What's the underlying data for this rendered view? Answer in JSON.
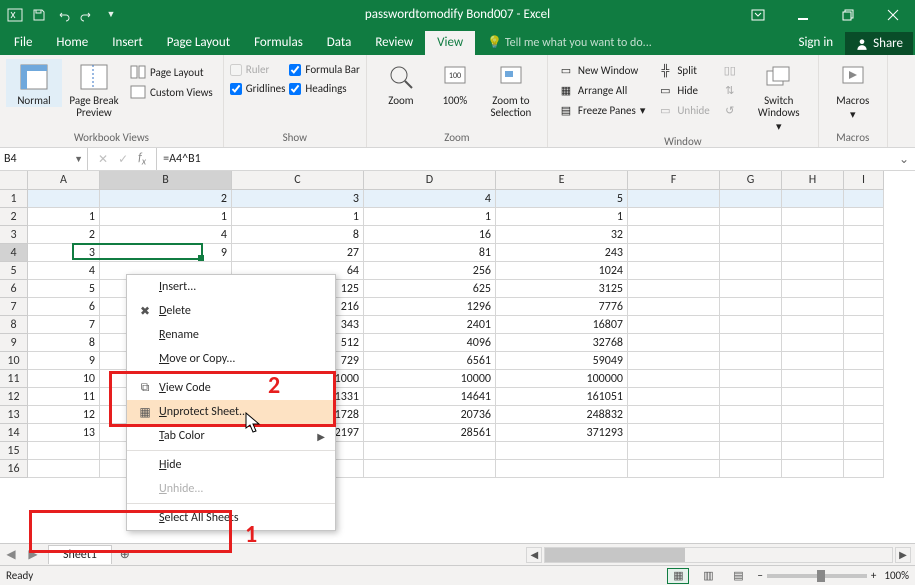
{
  "titlebar": {
    "title": "passwordtomodify Bond007 - Excel"
  },
  "tabs": {
    "file": "File",
    "items": [
      "Home",
      "Insert",
      "Page Layout",
      "Formulas",
      "Data",
      "Review",
      "View"
    ],
    "active": "View",
    "tell": "Tell me what you want to do...",
    "signin": "Sign in",
    "share": "Share"
  },
  "ribbon": {
    "views": {
      "normal": "Normal",
      "pagebreak": "Page Break Preview",
      "pagelayout": "Page Layout",
      "custom": "Custom Views",
      "label": "Workbook Views"
    },
    "show": {
      "ruler": "Ruler",
      "ruler_checked": false,
      "ruler_disabled": true,
      "formulabar": "Formula Bar",
      "formulabar_checked": true,
      "gridlines": "Gridlines",
      "gridlines_checked": true,
      "headings": "Headings",
      "headings_checked": true,
      "label": "Show"
    },
    "zoomg": {
      "zoom": "Zoom",
      "hundred": "100%",
      "zoomsel": "Zoom to Selection",
      "label": "Zoom"
    },
    "window": {
      "newwin": "New Window",
      "arrange": "Arrange All",
      "freeze": "Freeze Panes",
      "split": "Split",
      "hide": "Hide",
      "unhide": "Unhide",
      "sidebyside": "",
      "syncscroll": "",
      "reset": "",
      "switch": "Switch Windows",
      "label": "Window"
    },
    "macros": {
      "macros": "Macros",
      "label": "Macros"
    }
  },
  "formulaBar": {
    "name": "B4",
    "formula": "=A4^B1"
  },
  "grid": {
    "columns": [
      "A",
      "B",
      "C",
      "D",
      "E",
      "F",
      "G",
      "H",
      "I"
    ],
    "headerRow": [
      "",
      "2",
      "3",
      "4",
      "5",
      "",
      "",
      "",
      ""
    ],
    "rows": [
      [
        "1",
        "1",
        "1",
        "1",
        "1",
        "",
        "",
        "",
        ""
      ],
      [
        "2",
        "4",
        "8",
        "16",
        "32",
        "",
        "",
        "",
        ""
      ],
      [
        "3",
        "9",
        "27",
        "81",
        "243",
        "",
        "",
        "",
        ""
      ],
      [
        "4",
        "",
        "64",
        "256",
        "1024",
        "",
        "",
        "",
        ""
      ],
      [
        "5",
        "",
        "125",
        "625",
        "3125",
        "",
        "",
        "",
        ""
      ],
      [
        "6",
        "",
        "216",
        "1296",
        "7776",
        "",
        "",
        "",
        ""
      ],
      [
        "7",
        "",
        "343",
        "2401",
        "16807",
        "",
        "",
        "",
        ""
      ],
      [
        "8",
        "",
        "512",
        "4096",
        "32768",
        "",
        "",
        "",
        ""
      ],
      [
        "9",
        "",
        "729",
        "6561",
        "59049",
        "",
        "",
        "",
        ""
      ],
      [
        "10",
        "",
        "1000",
        "10000",
        "100000",
        "",
        "",
        "",
        ""
      ],
      [
        "11",
        "",
        "1331",
        "14641",
        "161051",
        "",
        "",
        "",
        ""
      ],
      [
        "12",
        "",
        "1728",
        "20736",
        "248832",
        "",
        "",
        "",
        ""
      ],
      [
        "13",
        "",
        "2197",
        "28561",
        "371293",
        "",
        "",
        "",
        ""
      ],
      [
        "",
        "",
        "",
        "",
        "",
        "",
        "",
        "",
        ""
      ],
      [
        "",
        "",
        "",
        "",
        "",
        "",
        "",
        "",
        ""
      ]
    ],
    "activeCol": "B",
    "activeRow": 4
  },
  "contextMenu": {
    "items": [
      {
        "label": "Insert...",
        "icon": "",
        "enabled": true
      },
      {
        "label": "Delete",
        "icon": "x",
        "enabled": true
      },
      {
        "label": "Rename",
        "icon": "",
        "enabled": true
      },
      {
        "label": "Move or Copy...",
        "icon": "",
        "enabled": true
      },
      {
        "label": "-"
      },
      {
        "label": "View Code",
        "icon": "code",
        "enabled": true
      },
      {
        "label": "Unprotect Sheet...",
        "icon": "sheet",
        "enabled": true,
        "hover": true
      },
      {
        "label": "Tab Color",
        "icon": "",
        "enabled": true,
        "arrow": true
      },
      {
        "label": "-"
      },
      {
        "label": "Hide",
        "icon": "",
        "enabled": true
      },
      {
        "label": "Unhide...",
        "icon": "",
        "enabled": false
      },
      {
        "label": "-"
      },
      {
        "label": "Select All Sheets",
        "icon": "",
        "enabled": true
      }
    ]
  },
  "annotations": {
    "n1": "1",
    "n2": "2"
  },
  "sheetbar": {
    "sheet": "Sheet1"
  },
  "status": {
    "mode": "Ready",
    "zoom": "100%"
  }
}
